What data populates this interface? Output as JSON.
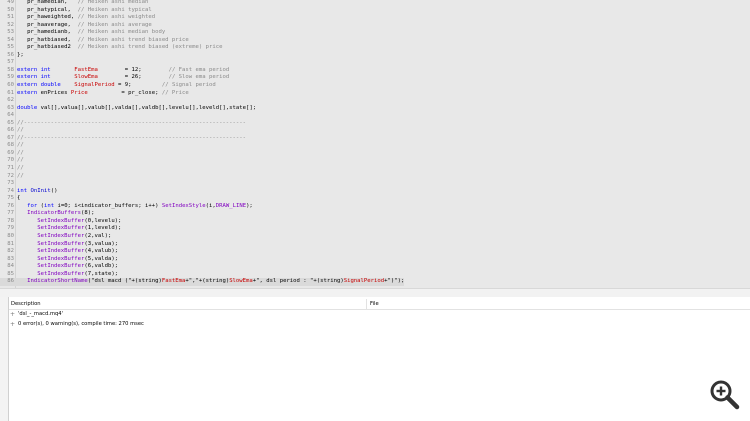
{
  "editor": {
    "lines": [
      {
        "n": "49",
        "t": [
          [
            "cb",
            "   pr_hamedian,   "
          ],
          [
            "c",
            "// Heiken ashi median"
          ]
        ]
      },
      {
        "n": "50",
        "t": [
          [
            "cb",
            "   pr_hatypical,  "
          ],
          [
            "c",
            "// Heiken ashi typical"
          ]
        ]
      },
      {
        "n": "51",
        "t": [
          [
            "cb",
            "   pr_haweighted, "
          ],
          [
            "c",
            "// Heiken ashi weighted"
          ]
        ]
      },
      {
        "n": "52",
        "t": [
          [
            "cb",
            "   pr_haaverage,  "
          ],
          [
            "c",
            "// Heiken ashi average"
          ]
        ]
      },
      {
        "n": "53",
        "t": [
          [
            "cb",
            "   pr_hamedianb,  "
          ],
          [
            "c",
            "// Heiken ashi median body"
          ]
        ]
      },
      {
        "n": "54",
        "t": [
          [
            "cb",
            "   pr_hatbiased,  "
          ],
          [
            "c",
            "// Heiken ashi trend biased price"
          ]
        ]
      },
      {
        "n": "55",
        "t": [
          [
            "cb",
            "   pr_hatbiased2  "
          ],
          [
            "c",
            "// Heiken ashi trend biased (extreme) price"
          ]
        ]
      },
      {
        "n": "56",
        "t": [
          [
            "cb",
            "};"
          ]
        ]
      },
      {
        "n": "57",
        "t": []
      },
      {
        "n": "58",
        "t": [
          [
            "k",
            "extern int       "
          ],
          [
            "v",
            "FastEma"
          ],
          [
            "cb",
            "        = 12;        "
          ],
          [
            "c",
            "// Fast ema period"
          ]
        ]
      },
      {
        "n": "59",
        "t": [
          [
            "k",
            "extern int       "
          ],
          [
            "v",
            "SlowEma"
          ],
          [
            "cb",
            "        = 26;        "
          ],
          [
            "c",
            "// Slow ema period"
          ]
        ]
      },
      {
        "n": "60",
        "t": [
          [
            "k",
            "extern double    "
          ],
          [
            "v",
            "SignalPeriod"
          ],
          [
            "cb",
            " = 9;         "
          ],
          [
            "c",
            "// Signal period"
          ]
        ]
      },
      {
        "n": "61",
        "t": [
          [
            "k",
            "extern "
          ],
          [
            "cb",
            "enPrices "
          ],
          [
            "v",
            "Price"
          ],
          [
            "cb",
            "          = pr_close; "
          ],
          [
            "c",
            "// Price"
          ]
        ]
      },
      {
        "n": "62",
        "t": []
      },
      {
        "n": "63",
        "t": [
          [
            "k",
            "double "
          ],
          [
            "cb",
            "val[],valua[],valub[],valda[],valdb[],levelu[],leveld[],state[];"
          ]
        ]
      },
      {
        "n": "64",
        "t": []
      },
      {
        "n": "65",
        "t": [
          [
            "c",
            "//------------------------------------------------------------------"
          ]
        ]
      },
      {
        "n": "66",
        "t": [
          [
            "c",
            "//"
          ]
        ]
      },
      {
        "n": "67",
        "t": [
          [
            "c",
            "//------------------------------------------------------------------"
          ]
        ]
      },
      {
        "n": "68",
        "t": [
          [
            "c",
            "//"
          ]
        ]
      },
      {
        "n": "69",
        "t": [
          [
            "c",
            "//"
          ]
        ]
      },
      {
        "n": "70",
        "t": [
          [
            "c",
            "//"
          ]
        ]
      },
      {
        "n": "71",
        "t": [
          [
            "c",
            "//"
          ]
        ]
      },
      {
        "n": "72",
        "t": [
          [
            "c",
            "//"
          ]
        ]
      },
      {
        "n": "73",
        "t": []
      },
      {
        "n": "74",
        "t": [
          [
            "k",
            "int "
          ],
          [
            "kc",
            "OnInit"
          ],
          [
            "cb",
            "()"
          ]
        ]
      },
      {
        "n": "75",
        "t": [
          [
            "cb",
            "{"
          ]
        ]
      },
      {
        "n": "76",
        "t": [
          [
            "cb",
            "   "
          ],
          [
            "k",
            "for "
          ],
          [
            "cb",
            "("
          ],
          [
            "k",
            "int "
          ],
          [
            "cb",
            "i=0; i<indicator_buffers; i++) "
          ],
          [
            "f",
            "SetIndexStyle"
          ],
          [
            "cb",
            "(i,"
          ],
          [
            "f",
            "DRAW_LINE"
          ],
          [
            "cb",
            ");"
          ]
        ]
      },
      {
        "n": "77",
        "t": [
          [
            "cb",
            "   "
          ],
          [
            "f",
            "IndicatorBuffers"
          ],
          [
            "cb",
            "(8);"
          ]
        ]
      },
      {
        "n": "78",
        "t": [
          [
            "cb",
            "      "
          ],
          [
            "f",
            "SetIndexBuffer"
          ],
          [
            "cb",
            "(0,levelu);"
          ]
        ]
      },
      {
        "n": "79",
        "t": [
          [
            "cb",
            "      "
          ],
          [
            "f",
            "SetIndexBuffer"
          ],
          [
            "cb",
            "(1,leveld);"
          ]
        ]
      },
      {
        "n": "80",
        "t": [
          [
            "cb",
            "      "
          ],
          [
            "f",
            "SetIndexBuffer"
          ],
          [
            "cb",
            "(2,val);"
          ]
        ]
      },
      {
        "n": "81",
        "t": [
          [
            "cb",
            "      "
          ],
          [
            "f",
            "SetIndexBuffer"
          ],
          [
            "cb",
            "(3,valua);"
          ]
        ]
      },
      {
        "n": "82",
        "t": [
          [
            "cb",
            "      "
          ],
          [
            "f",
            "SetIndexBuffer"
          ],
          [
            "cb",
            "(4,valub);"
          ]
        ]
      },
      {
        "n": "83",
        "t": [
          [
            "cb",
            "      "
          ],
          [
            "f",
            "SetIndexBuffer"
          ],
          [
            "cb",
            "(5,valda);"
          ]
        ]
      },
      {
        "n": "84",
        "t": [
          [
            "cb",
            "      "
          ],
          [
            "f",
            "SetIndexBuffer"
          ],
          [
            "cb",
            "(6,valdb);"
          ]
        ]
      },
      {
        "n": "85",
        "t": [
          [
            "cb",
            "      "
          ],
          [
            "f",
            "SetIndexBuffer"
          ],
          [
            "cb",
            "(7,state);"
          ]
        ]
      },
      {
        "n": "86",
        "t": [
          [
            "cb",
            "   "
          ],
          [
            "f",
            "IndicatorShortName"
          ],
          [
            "cb",
            "(\"dsl macd (\"+(string)"
          ],
          [
            "v",
            "FastEma"
          ],
          [
            "cb",
            "+\",\"+(string)"
          ],
          [
            "v",
            "SlowEma"
          ],
          [
            "cb",
            "+\", dsl period : \"+(string)"
          ],
          [
            "v",
            "SignalPeriod"
          ],
          [
            "cb",
            "+\")\");"
          ]
        ],
        "highlight": true
      }
    ]
  },
  "toolbox": {
    "col_description": "Description",
    "col_file": "File",
    "rows": [
      {
        "icon": "+",
        "text": "'dsl_-_macd.mq4'"
      },
      {
        "icon": "+",
        "text": "0 error(s), 0 warning(s), compile time: 270 msec"
      }
    ]
  },
  "zoom_icon": "magnifier-plus-icon"
}
